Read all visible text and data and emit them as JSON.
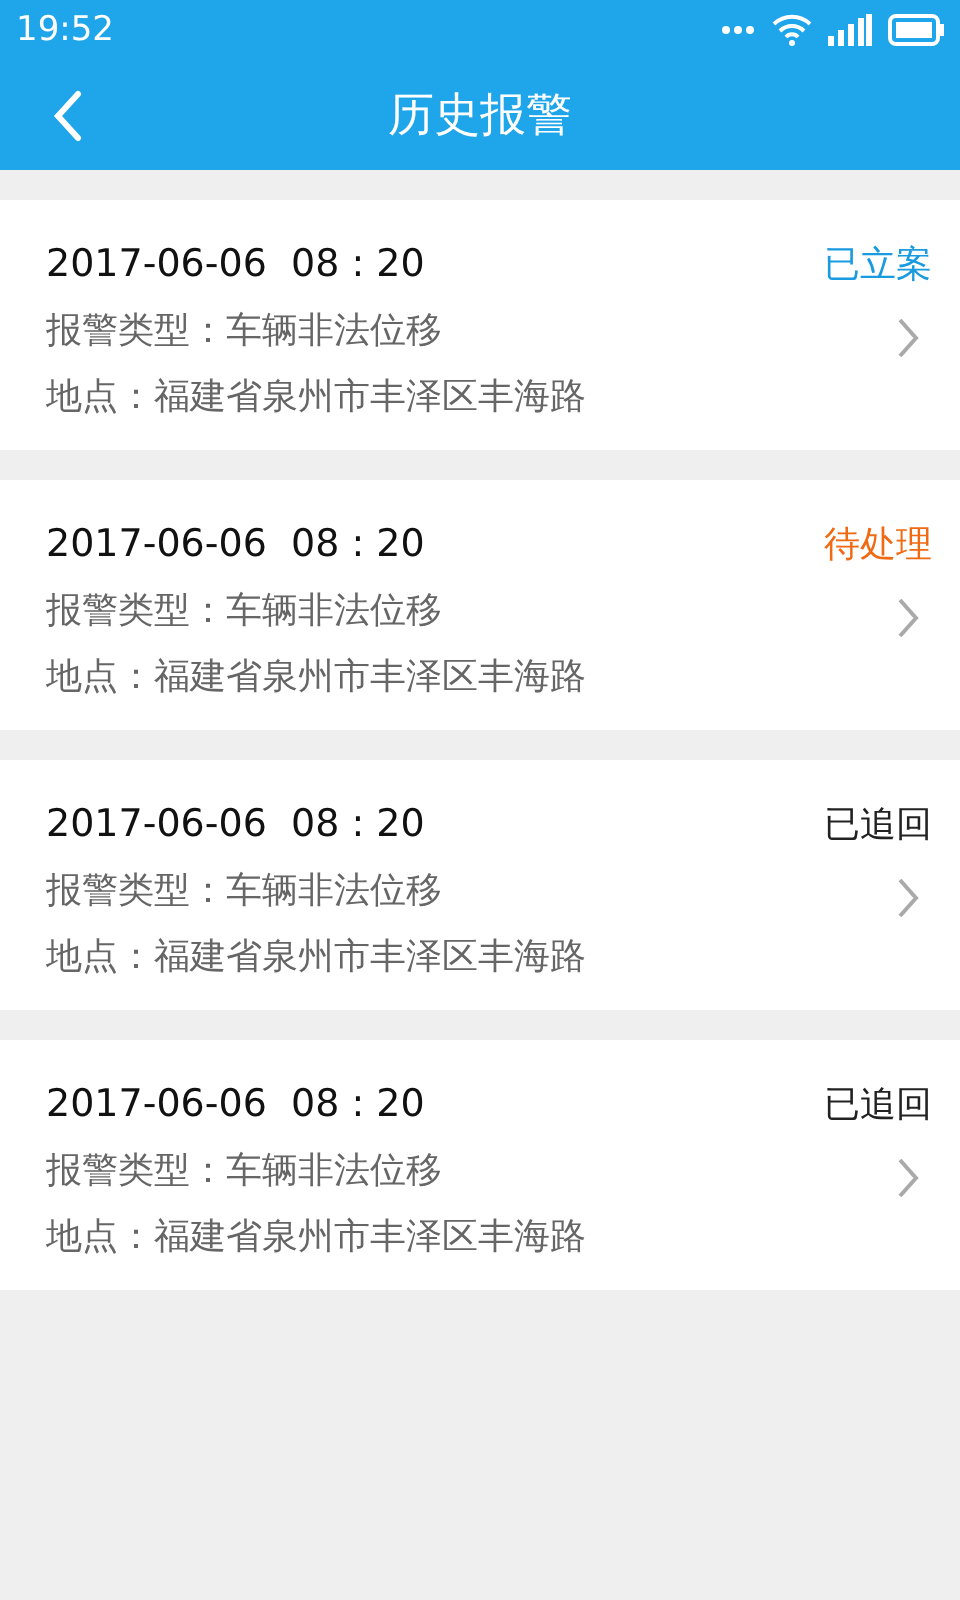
{
  "status_bar": {
    "time": "19:52"
  },
  "header": {
    "title": "历史报警"
  },
  "records": [
    {
      "datetime": "2017-06-06  08 : 20",
      "status": "已立案",
      "color": "#1a9be0",
      "type": "报警类型：车辆非法位移",
      "location": "地点：福建省泉州市丰泽区丰海路"
    },
    {
      "datetime": "2017-06-06  08 : 20",
      "status": "待处理",
      "color": "#f06a14",
      "type": "报警类型：车辆非法位移",
      "location": "地点：福建省泉州市丰泽区丰海路"
    },
    {
      "datetime": "2017-06-06  08 : 20",
      "status": "已追回",
      "color": "#222222",
      "type": "报警类型：车辆非法位移",
      "location": "地点：福建省泉州市丰泽区丰海路"
    },
    {
      "datetime": "2017-06-06  08 : 20",
      "status": "已追回",
      "color": "#222222",
      "type": "报警类型：车辆非法位移",
      "location": "地点：福建省泉州市丰泽区丰海路"
    }
  ]
}
